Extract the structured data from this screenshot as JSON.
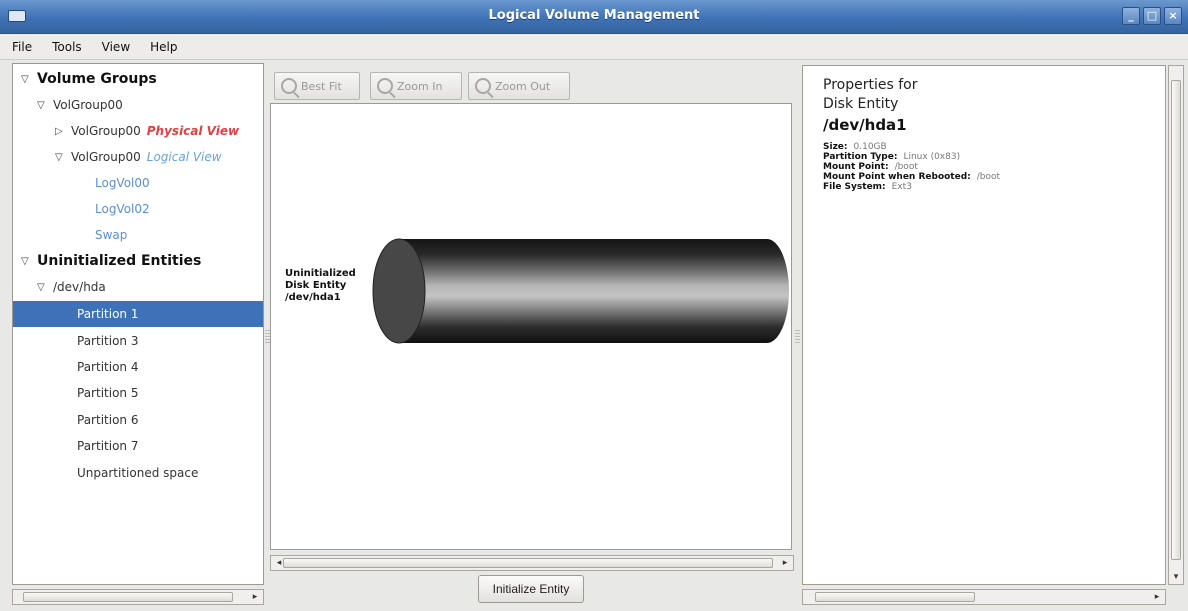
{
  "window": {
    "title": "Logical Volume Management",
    "buttons": [
      "_",
      "□",
      "×"
    ]
  },
  "menu": [
    "File",
    "Tools",
    "View",
    "Help"
  ],
  "tree": {
    "volume_groups_label": "Volume Groups",
    "vg_name": "VolGroup00",
    "physical_view_row": "VolGroup00",
    "physical_view_tag": "Physical View",
    "logical_view_row": "VolGroup00",
    "logical_view_tag": "Logical View",
    "logical_volumes": [
      "LogVol00",
      "LogVol02",
      "Swap"
    ],
    "uninit_label": "Uninitialized Entities",
    "device": "/dev/hda",
    "partitions": [
      "Partition 1",
      "Partition 3",
      "Partition 4",
      "Partition 5",
      "Partition 6",
      "Partition 7",
      "Unpartitioned space"
    ],
    "selected": "Partition 1"
  },
  "toolbar": {
    "best_fit": "Best Fit",
    "zoom_in": "Zoom In",
    "zoom_out": "Zoom Out"
  },
  "canvas": {
    "entity_lines": [
      "Uninitialized",
      "Disk Entity",
      "/dev/hda1"
    ]
  },
  "init_button": "Initialize Entity",
  "properties": {
    "heading_line1": "Properties for",
    "heading_line2": "Disk Entity",
    "device": "/dev/hda1",
    "fields": [
      {
        "key": "Size:",
        "value": "0.10GB"
      },
      {
        "key": "Partition Type:",
        "value": "Linux (0x83)"
      },
      {
        "key": "Mount Point:",
        "value": "/boot"
      },
      {
        "key": "Mount Point when Rebooted:",
        "value": "/boot"
      },
      {
        "key": "File System:",
        "value": "Ext3"
      }
    ]
  }
}
